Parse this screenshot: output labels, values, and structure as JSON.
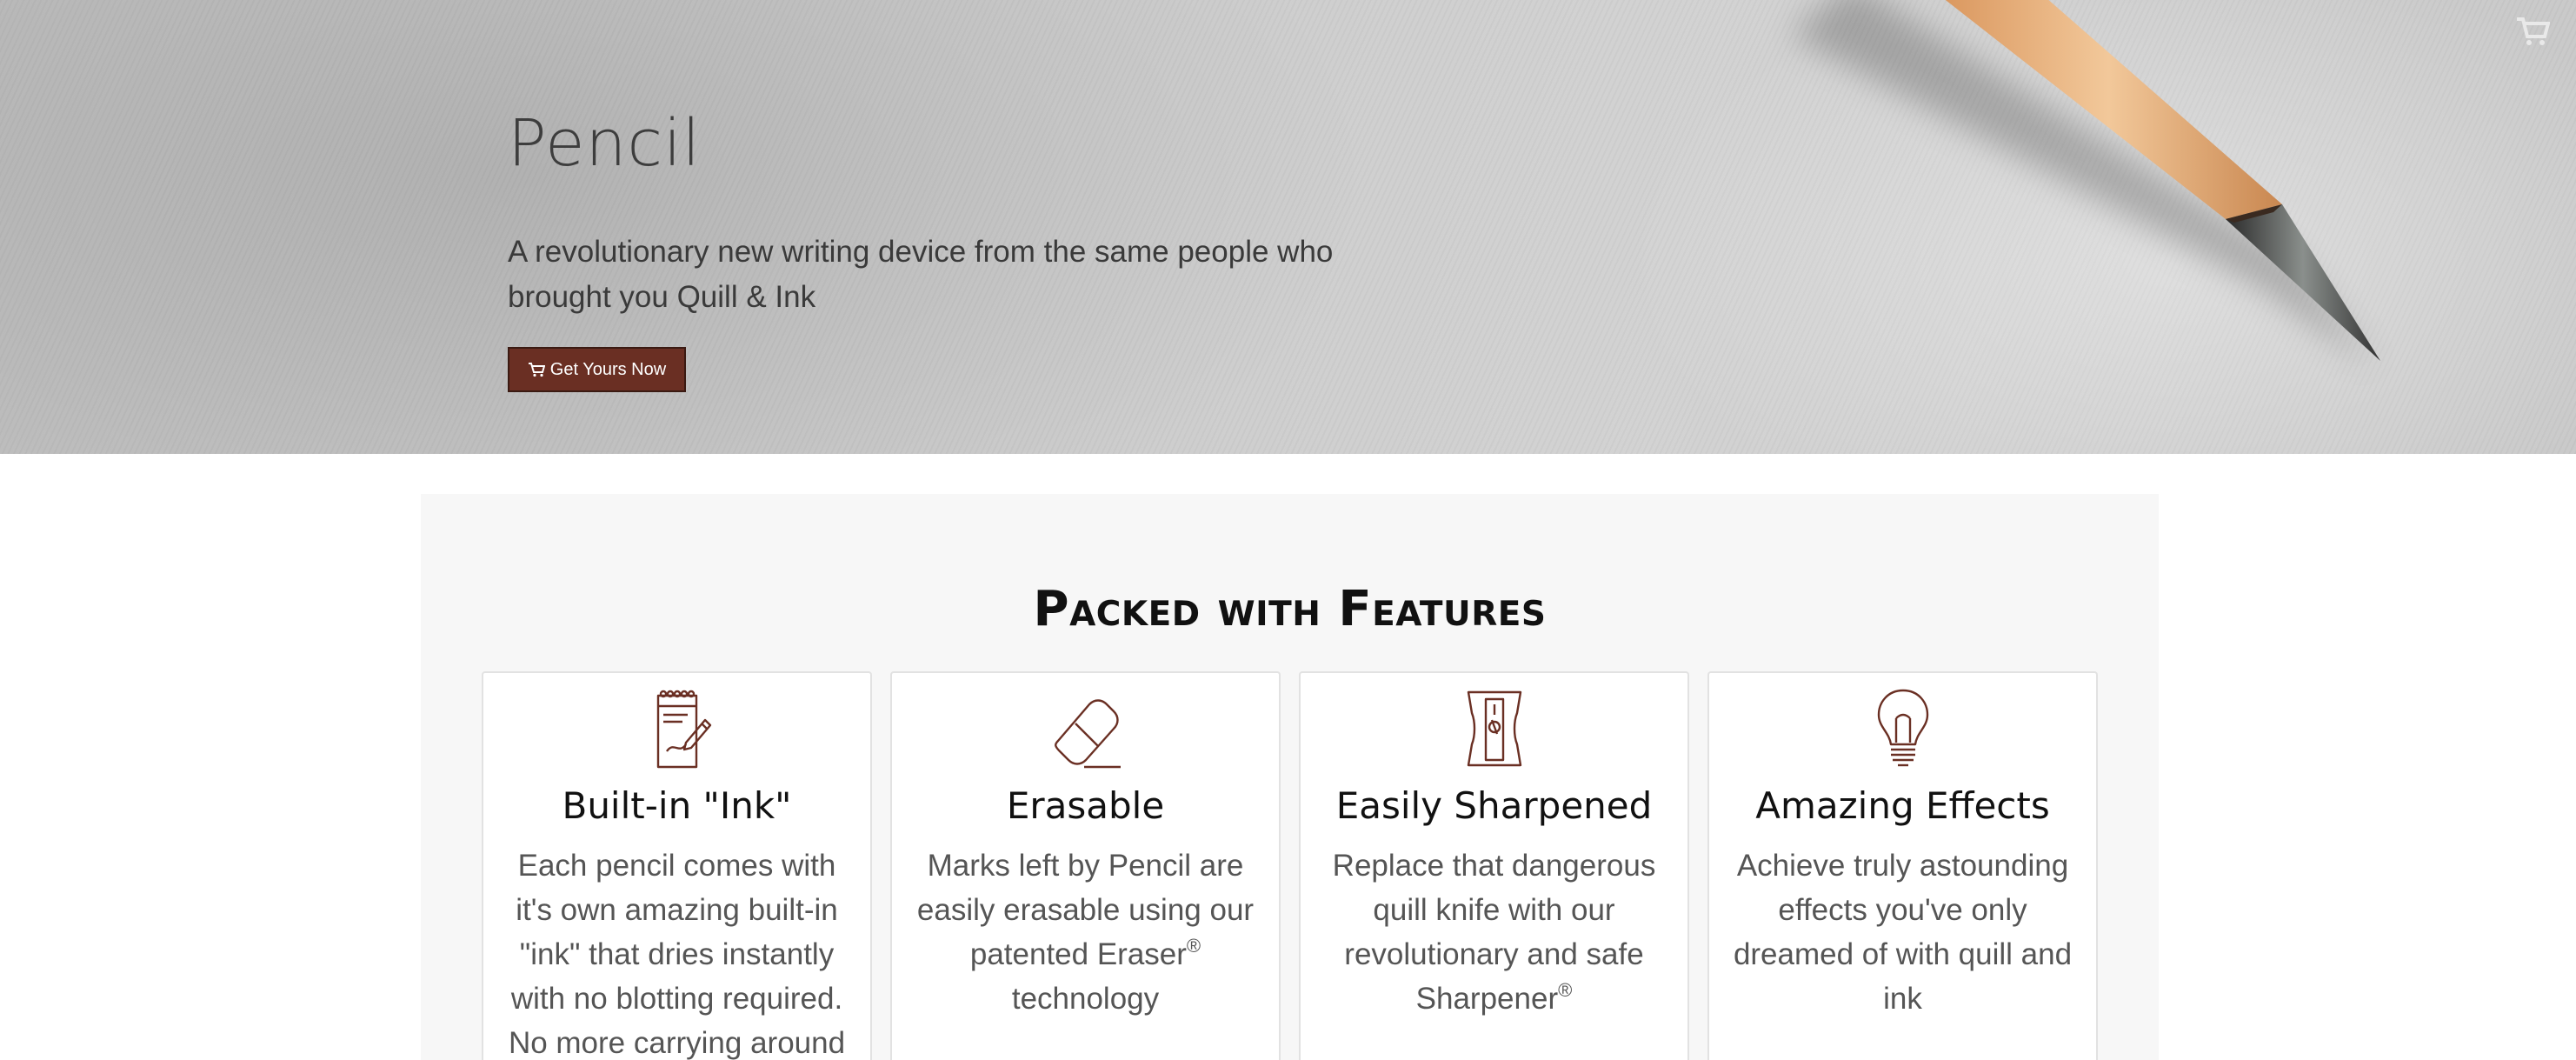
{
  "hero": {
    "title": "Pencil",
    "subtitle": "A revolutionary new writing device from the same people who brought you Quill & Ink",
    "cta_label": "Get Yours Now"
  },
  "features": {
    "title": "Packed with Features",
    "cards": [
      {
        "icon": "notepad-pencil-icon",
        "title": "Built-in \"Ink\"",
        "text": "Each pencil comes with it's own amazing built-in \"ink\" that dries instantly with no blotting required. No more carrying around a separate",
        "mark": ""
      },
      {
        "icon": "eraser-icon",
        "title": "Erasable",
        "text": "Marks left by Pencil are easily erasable using our patented Eraser",
        "mark": "®",
        "after": " technology"
      },
      {
        "icon": "sharpener-icon",
        "title": "Easily Sharpened",
        "text": "Replace that dangerous quill knife with our revolutionary and safe Sharpener",
        "mark": "®",
        "after": ""
      },
      {
        "icon": "lightbulb-icon",
        "title": "Amazing Effects",
        "text": "Achieve truly astounding effects you've only dreamed of with quill and ink",
        "mark": "",
        "after": ""
      }
    ]
  },
  "colors": {
    "accent": "#6a2f23",
    "icon_stroke": "#6a2f23",
    "panel": "#f7f7f7"
  }
}
